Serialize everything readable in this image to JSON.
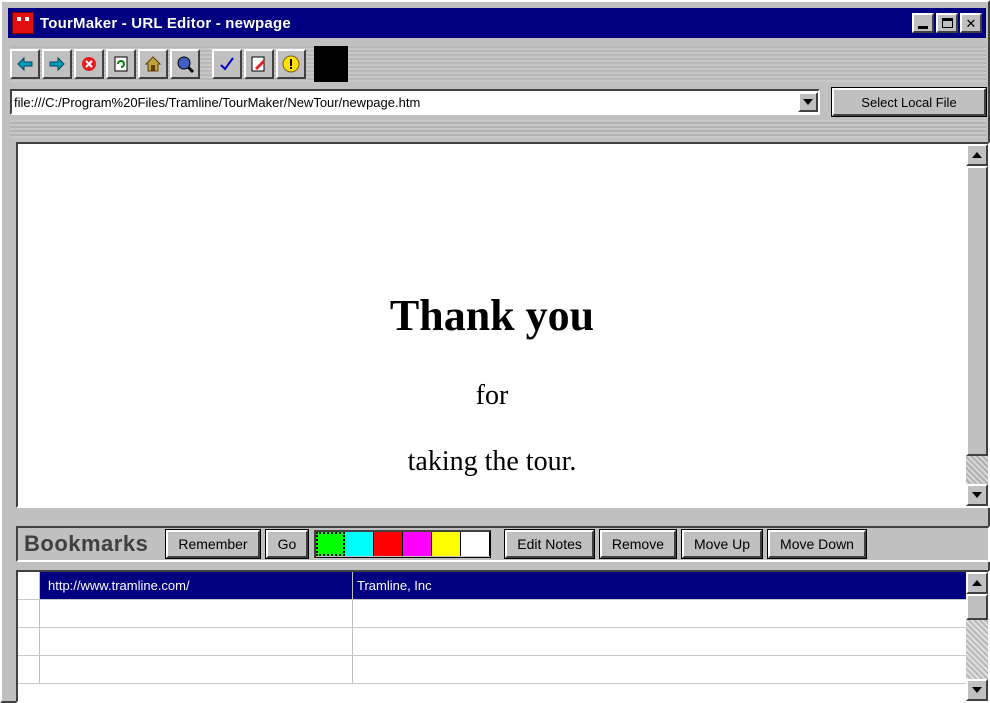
{
  "window": {
    "title": "TourMaker - URL Editor - newpage",
    "controls": {
      "minimize": "_",
      "maximize": "□",
      "close": "✕"
    }
  },
  "toolbar": {
    "buttons": [
      {
        "name": "back",
        "icon": "back-arrow-icon",
        "color": "#00a0a0"
      },
      {
        "name": "forward",
        "icon": "forward-arrow-icon",
        "color": "#00a0a0"
      },
      {
        "name": "stop",
        "icon": "stop-icon",
        "color": "#e00000"
      },
      {
        "name": "refresh",
        "icon": "refresh-icon",
        "color": "#008000"
      },
      {
        "name": "home",
        "icon": "home-icon",
        "color": "#808000"
      },
      {
        "name": "search",
        "icon": "search-globe-icon",
        "color": "#000080"
      },
      {
        "name": "check",
        "icon": "checkmark-icon",
        "color": "#0000c0"
      },
      {
        "name": "edit",
        "icon": "edit-page-icon",
        "color": "#c00000"
      },
      {
        "name": "alert",
        "icon": "warning-icon",
        "color": "#f0e000"
      }
    ],
    "color_swatch": "#000000"
  },
  "url_bar": {
    "value": "file:///C:/Program%20Files/Tramline/TourMaker/NewTour/newpage.htm",
    "select_local_file_label": "Select Local File"
  },
  "page": {
    "heading": "Thank you",
    "line1": "for",
    "line2": "taking the tour."
  },
  "bookmarks": {
    "label": "Bookmarks",
    "remember_label": "Remember",
    "go_label": "Go",
    "colors": [
      "#00ff00",
      "#00ffff",
      "#ff0000",
      "#ff00ff",
      "#ffff00",
      "#ffffff"
    ],
    "edit_notes_label": "Edit Notes",
    "remove_label": "Remove",
    "move_up_label": "Move Up",
    "move_down_label": "Move Down",
    "rows": [
      {
        "url": "http://www.tramline.com/",
        "title": "Tramline, Inc",
        "selected": true
      },
      {
        "url": "",
        "title": ""
      },
      {
        "url": "",
        "title": ""
      },
      {
        "url": "",
        "title": ""
      }
    ]
  }
}
